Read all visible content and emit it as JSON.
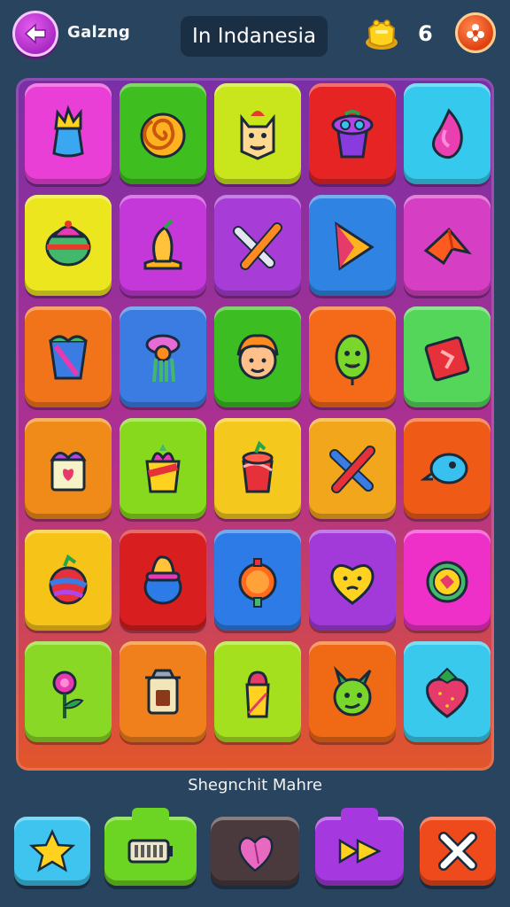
{
  "header": {
    "game_title": "Galzng",
    "level_name": "In Indanesia",
    "score": "6"
  },
  "colors": {
    "background": "#28445f",
    "board_top": "#7a2fa6",
    "board_bottom": "#e2562a"
  },
  "board": {
    "rows": [
      [
        {
          "color": "#e93fd6",
          "icon": "crown-cup-icon"
        },
        {
          "color": "#3fbf1f",
          "icon": "swirl-icon"
        },
        {
          "color": "#c9e61c",
          "icon": "cat-mask-icon"
        },
        {
          "color": "#e62424",
          "icon": "masked-pot-icon"
        },
        {
          "color": "#36c9ee",
          "icon": "flame-drop-icon"
        }
      ],
      [
        {
          "color": "#ece61f",
          "icon": "cupcake-icon"
        },
        {
          "color": "#c437d9",
          "icon": "mango-icon"
        },
        {
          "color": "#a73dd6",
          "icon": "crossed-pens-icon"
        },
        {
          "color": "#2f84e3",
          "icon": "play-arrow-icon"
        },
        {
          "color": "#d63fc3",
          "icon": "paper-plane-icon"
        }
      ],
      [
        {
          "color": "#f2741a",
          "icon": "vase-icon"
        },
        {
          "color": "#3a7ce2",
          "icon": "jellyfish-icon"
        },
        {
          "color": "#3cbd22",
          "icon": "boy-face-icon"
        },
        {
          "color": "#f46a18",
          "icon": "balloon-creature-icon"
        },
        {
          "color": "#54d65a",
          "icon": "card-icon"
        }
      ],
      [
        {
          "color": "#f08a18",
          "icon": "gift-box-icon"
        },
        {
          "color": "#86d91d",
          "icon": "gift-cup-icon"
        },
        {
          "color": "#f4c81c",
          "icon": "strawberry-cup-icon"
        },
        {
          "color": "#f2a61c",
          "icon": "crossed-brushes-icon"
        },
        {
          "color": "#ef5a17",
          "icon": "bubble-icon"
        }
      ],
      [
        {
          "color": "#f6c318",
          "icon": "fruit-jar-icon"
        },
        {
          "color": "#d81e1e",
          "icon": "sundae-icon"
        },
        {
          "color": "#2c7be6",
          "icon": "orange-lollipop-icon"
        },
        {
          "color": "#a23ad9",
          "icon": "heart-face-icon"
        },
        {
          "color": "#ee2fc8",
          "icon": "coin-badge-icon"
        }
      ],
      [
        {
          "color": "#8ad826",
          "icon": "flower-icon"
        },
        {
          "color": "#f0801b",
          "icon": "lantern-icon"
        },
        {
          "color": "#a5e01e",
          "icon": "bottle-icon"
        },
        {
          "color": "#f06a16",
          "icon": "dragon-icon"
        },
        {
          "color": "#39c9ec",
          "icon": "strawberry-icon"
        }
      ]
    ]
  },
  "caption": "Shegnchit Mahre",
  "bottom_bar": [
    {
      "name": "star-button",
      "icon": "star-icon",
      "color": "#3ec4ee"
    },
    {
      "name": "battery-button",
      "icon": "battery-icon",
      "color": "#6cd422"
    },
    {
      "name": "heart-button",
      "icon": "leaf-heart-icon",
      "color": "#4a3a3e"
    },
    {
      "name": "fast-forward-button",
      "icon": "fast-forward-icon",
      "color": "#a638e0"
    },
    {
      "name": "close-button",
      "icon": "close-icon",
      "color": "#ef4a1c"
    }
  ]
}
